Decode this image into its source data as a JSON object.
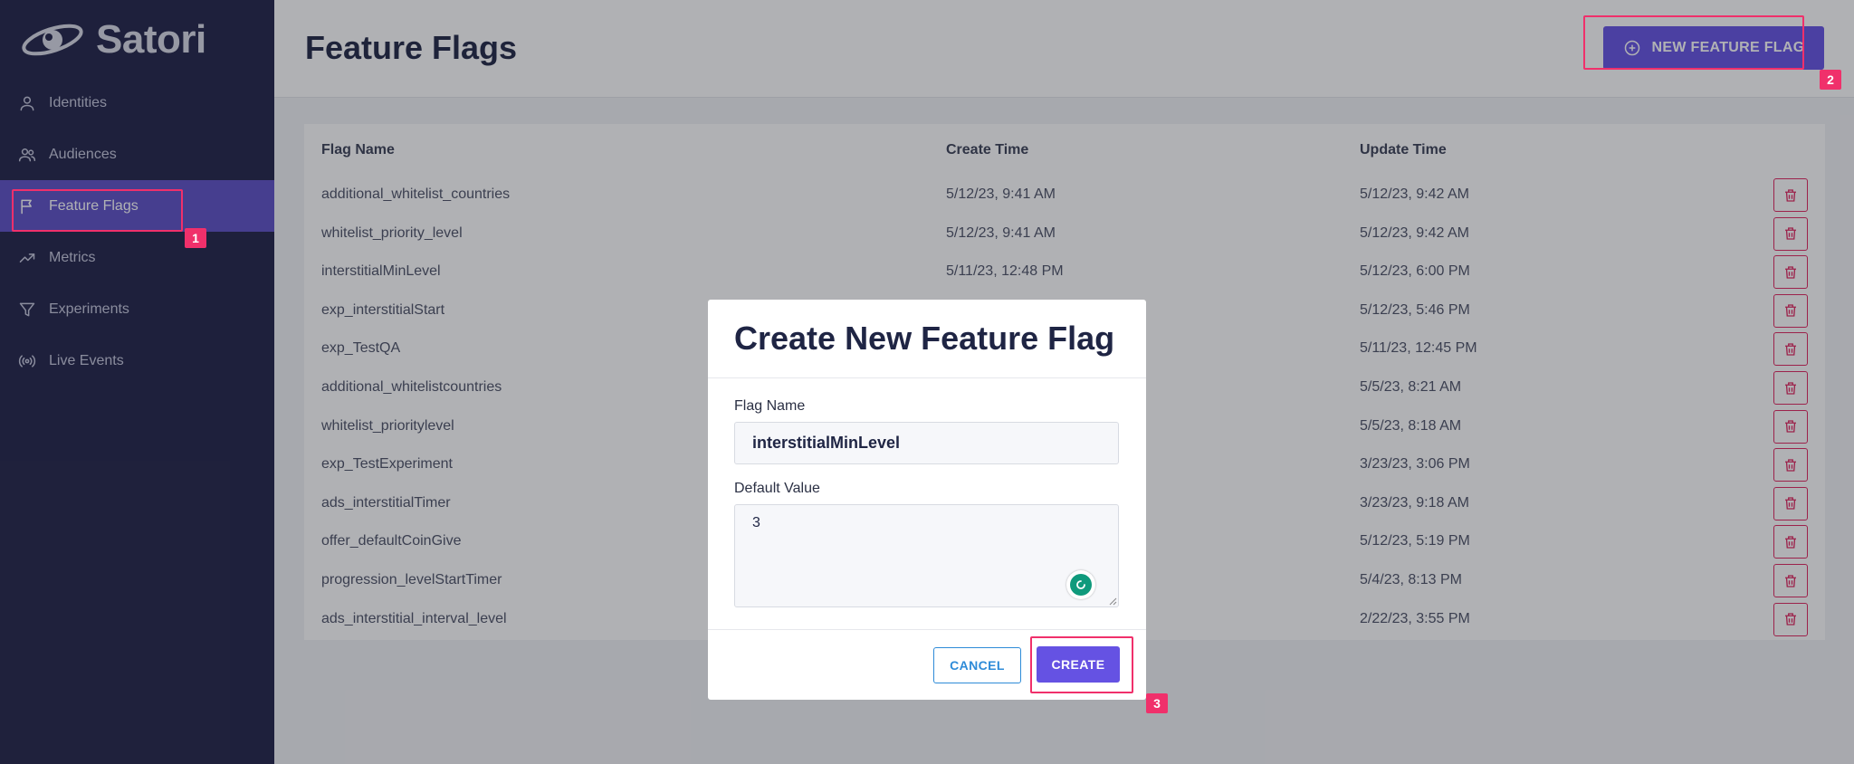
{
  "brand": {
    "name": "Satori"
  },
  "sidebar": {
    "items": [
      {
        "label": "Identities",
        "icon": "user-icon"
      },
      {
        "label": "Audiences",
        "icon": "users-icon"
      },
      {
        "label": "Feature Flags",
        "icon": "flag-icon",
        "active": true
      },
      {
        "label": "Metrics",
        "icon": "trending-up-icon"
      },
      {
        "label": "Experiments",
        "icon": "filter-icon"
      },
      {
        "label": "Live Events",
        "icon": "broadcast-icon"
      }
    ]
  },
  "header": {
    "title": "Feature Flags",
    "new_button_label": "NEW FEATURE FLAG"
  },
  "table": {
    "columns": [
      "Flag Name",
      "Create Time",
      "Update Time"
    ],
    "rows": [
      {
        "name": "additional_whitelist_countries",
        "created": "5/12/23, 9:41 AM",
        "updated": "5/12/23, 9:42 AM"
      },
      {
        "name": "whitelist_priority_level",
        "created": "5/12/23, 9:41 AM",
        "updated": "5/12/23, 9:42 AM"
      },
      {
        "name": "interstitialMinLevel",
        "created": "5/11/23, 12:48 PM",
        "updated": "5/12/23, 6:00 PM"
      },
      {
        "name": "exp_interstitialStart",
        "created": "",
        "updated": "5/12/23, 5:46 PM"
      },
      {
        "name": "exp_TestQA",
        "created": "",
        "updated": "5/11/23, 12:45 PM"
      },
      {
        "name": "additional_whitelistcountries",
        "created": "",
        "updated": "5/5/23, 8:21 AM"
      },
      {
        "name": "whitelist_prioritylevel",
        "created": "",
        "updated": "5/5/23, 8:18 AM"
      },
      {
        "name": "exp_TestExperiment",
        "created": "",
        "updated": "3/23/23, 3:06 PM"
      },
      {
        "name": "ads_interstitialTimer",
        "created": "",
        "updated": "3/23/23, 9:18 AM"
      },
      {
        "name": "offer_defaultCoinGive",
        "created": "",
        "updated": "5/12/23, 5:19 PM"
      },
      {
        "name": "progression_levelStartTimer",
        "created": "",
        "updated": "5/4/23, 8:13 PM"
      },
      {
        "name": "ads_interstitial_interval_level",
        "created": "",
        "updated": "2/22/23, 3:55 PM"
      }
    ]
  },
  "modal": {
    "title": "Create New Feature Flag",
    "flag_name_label": "Flag Name",
    "flag_name_value": "interstitialMinLevel",
    "default_value_label": "Default Value",
    "default_value_value": "3",
    "cancel_label": "CANCEL",
    "create_label": "CREATE"
  },
  "annotations": [
    "1",
    "2",
    "3"
  ],
  "colors": {
    "sidebar_bg": "#1f2147",
    "accent": "#6552e3",
    "danger": "#e0245e",
    "highlight": "#f0306b",
    "link_blue": "#2e8bd8"
  }
}
